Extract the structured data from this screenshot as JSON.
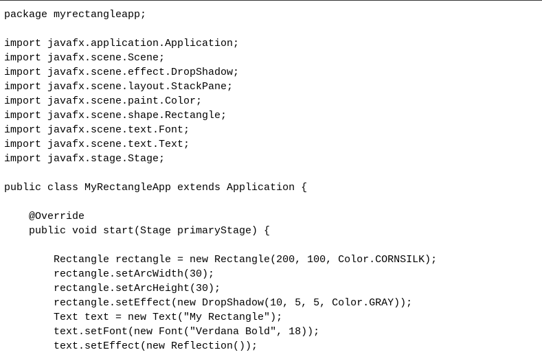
{
  "code": {
    "lines": [
      "package myrectangleapp;",
      "",
      "import javafx.application.Application;",
      "import javafx.scene.Scene;",
      "import javafx.scene.effect.DropShadow;",
      "import javafx.scene.layout.StackPane;",
      "import javafx.scene.paint.Color;",
      "import javafx.scene.shape.Rectangle;",
      "import javafx.scene.text.Font;",
      "import javafx.scene.text.Text;",
      "import javafx.stage.Stage;",
      "",
      "public class MyRectangleApp extends Application {",
      "",
      "    @Override",
      "    public void start(Stage primaryStage) {",
      "",
      "        Rectangle rectangle = new Rectangle(200, 100, Color.CORNSILK);",
      "        rectangle.setArcWidth(30);",
      "        rectangle.setArcHeight(30);",
      "        rectangle.setEffect(new DropShadow(10, 5, 5, Color.GRAY));",
      "        Text text = new Text(\"My Rectangle\");",
      "        text.setFont(new Font(\"Verdana Bold\", 18));",
      "        text.setEffect(new Reflection());"
    ]
  }
}
